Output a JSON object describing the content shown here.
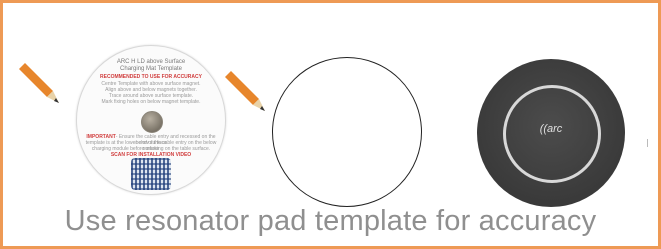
{
  "template": {
    "title_1": "ARC H LD above Surface",
    "title_2": "Charging Mat Template",
    "recommended": "RECOMMENDED TO USE FOR ACCURACY",
    "instructions": [
      "Centre Template with above surface magnet.",
      "Align above and below magnets together.",
      "Trace around above surface template.",
      "Mark fixing holes on below magnet template."
    ],
    "important_label": "IMPORTANT",
    "important_text": [
      "- Ensure the cable entry and recessed on the below surface",
      "template is at the lower end of the cable entry on the below surface",
      "charging module before marking on the table surface."
    ],
    "scan": "SCAN FOR INSTALLATION VIDEO"
  },
  "pad": {
    "logo": "((arc"
  },
  "caption": "Use resonator pad template for accuracy"
}
